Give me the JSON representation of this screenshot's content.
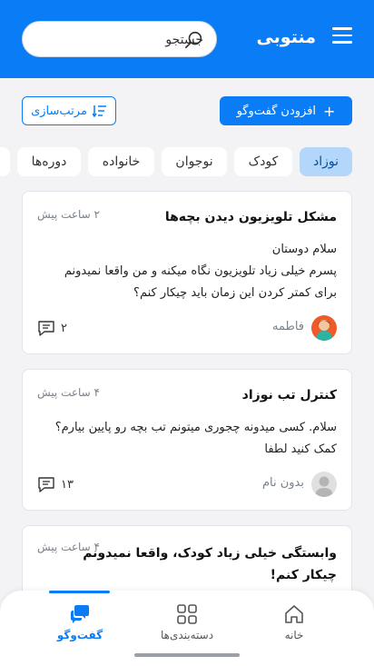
{
  "header": {
    "title": "منتوبی",
    "search_placeholder": "جستجو",
    "menu_icon": "menu-icon",
    "search_icon": "search-icon"
  },
  "toolbar": {
    "add_label": "افزودن گفت‌وگو",
    "sort_label": "مرتب‌سازی"
  },
  "tabs": [
    {
      "label": "نوزاد",
      "active": true
    },
    {
      "label": "کودک",
      "active": false
    },
    {
      "label": "نوجوان",
      "active": false
    },
    {
      "label": "خانواده",
      "active": false
    },
    {
      "label": "دوره‌ها",
      "active": false
    }
  ],
  "posts": [
    {
      "title": "مشکل تلویزیون دیدن بچه‌ها",
      "time": "۲ ساعت پیش",
      "body_lines": [
        "سلام دوستان",
        "پسرم خیلی زیاد تلویزیون نگاه میکنه و من واقعا نمیدونم",
        "برای کمتر کردن این زمان باید چیکار کنم؟"
      ],
      "author": "فاطمه",
      "comments": "۲"
    },
    {
      "title": "کنترل تب نوزاد",
      "time": "۴ ساعت پیش",
      "body_lines": [
        "سلام. کسی میدونه چجوری میتونم تب بچه رو پایین بیارم؟",
        "کمک کنید لطفا"
      ],
      "author": "بدون نام",
      "comments": "۱۳"
    },
    {
      "title_lines": [
        "وابستگی خیلی زیاد کودک، واقعا نمیدونم",
        "چیکار کنم!"
      ],
      "time": "۴ ساعت پیش"
    }
  ],
  "bottom_nav": {
    "home": "خانه",
    "categories": "دسته‌بندی‌ها",
    "chat": "گفت‌وگو"
  },
  "colors": {
    "primary": "#0a7cf5",
    "tab_active_bg": "#b3d6fb",
    "background": "#f3f3f5"
  }
}
